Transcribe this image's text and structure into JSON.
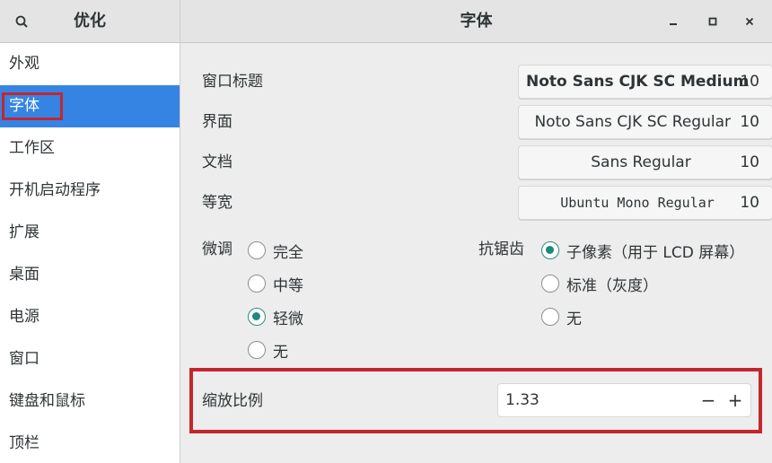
{
  "header": {
    "left_title": "优化",
    "main_title": "字体",
    "search_icon": "search-icon",
    "minimize_icon": "minimize-icon",
    "maximize_icon": "maximize-icon",
    "close_icon": "close-icon"
  },
  "sidebar": {
    "items": [
      {
        "label": "外观"
      },
      {
        "label": "字体"
      },
      {
        "label": "工作区"
      },
      {
        "label": "开机启动程序"
      },
      {
        "label": "扩展"
      },
      {
        "label": "桌面"
      },
      {
        "label": "电源"
      },
      {
        "label": "窗口"
      },
      {
        "label": "键盘和鼠标"
      },
      {
        "label": "顶栏"
      }
    ],
    "active_index": 1
  },
  "fonts": [
    {
      "label": "窗口标题",
      "font": "Noto Sans CJK SC Medium",
      "size": "10"
    },
    {
      "label": "界面",
      "font": "Noto Sans CJK SC Regular",
      "size": "10"
    },
    {
      "label": "文档",
      "font": "Sans Regular",
      "size": "10"
    },
    {
      "label": "等宽",
      "font": "Ubuntu Mono Regular",
      "size": "10"
    }
  ],
  "hinting": {
    "label": "微调",
    "options": [
      "完全",
      "中等",
      "轻微",
      "无"
    ],
    "selected": "轻微"
  },
  "antialiasing": {
    "label": "抗锯齿",
    "options": [
      "子像素（用于 LCD 屏幕）",
      "标准（灰度）",
      "无"
    ],
    "selected": "子像素（用于 LCD 屏幕）"
  },
  "scaling": {
    "label": "缩放比例",
    "value": "1.33",
    "decrement": "−",
    "increment": "+"
  },
  "colors": {
    "accent": "#3584e4",
    "radio_checked": "#1d8a7c",
    "highlight_box": "#c4262e"
  }
}
